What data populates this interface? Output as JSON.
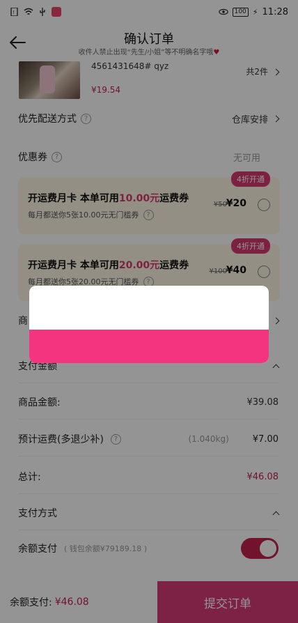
{
  "status": {
    "battery": "100",
    "time": "11:28",
    "icons": [
      "sim-icon",
      "wifi-icon",
      "usb-icon",
      "app-icon",
      "eye-icon",
      "battery-icon",
      "charging-icon"
    ]
  },
  "nav": {
    "title": "确认订单",
    "subtitle": "收件人禁止出现“先生/小姐”等不明确名字哦",
    "back_icon": "arrow-left-icon"
  },
  "product": {
    "id_text": "4561431648# qyz",
    "price": "¥19.54",
    "qty": "共2件"
  },
  "delivery": {
    "label": "优先配送方式",
    "value": "仓库安排"
  },
  "coupon": {
    "label": "优惠券",
    "value": "无可用"
  },
  "coupon_cards": [
    {
      "badge": "4折开通",
      "title_pre": "开运费月卡 本单可用",
      "title_amount": "10.00元",
      "title_post": "运费券",
      "desc": "每月都送你5张10.00元无门槛券",
      "old": "¥50",
      "new": "¥20"
    },
    {
      "badge": "4折开通",
      "title_pre": "开运费月卡 本单可用",
      "title_amount": "20.00元",
      "title_post": "运费券",
      "desc": "每月都送你5张20.00元无门槛券",
      "old": "¥100",
      "new": "¥40"
    }
  ],
  "partial_row": {
    "label": "商"
  },
  "payment": {
    "amount_label": "支付金额",
    "goods_label": "商品金额:",
    "goods_value": "¥39.08",
    "shipping_label": "预计运费(多退少补)",
    "shipping_weight": "(1.040kg)",
    "shipping_value": "¥7.00",
    "total_label": "总计:",
    "total_value": "¥46.08",
    "method_label": "支付方式",
    "balance_label": "余额支付",
    "balance_note": "( 钱包余额¥79189.18 )",
    "balance_toggle": true
  },
  "bottom": {
    "balance_label": "余额支付:",
    "balance_value": "¥46.08",
    "submit": "提交订单"
  },
  "colors": {
    "accent": "#d83a78",
    "modal_footer": "#f5347f",
    "price": "#c3224b"
  }
}
